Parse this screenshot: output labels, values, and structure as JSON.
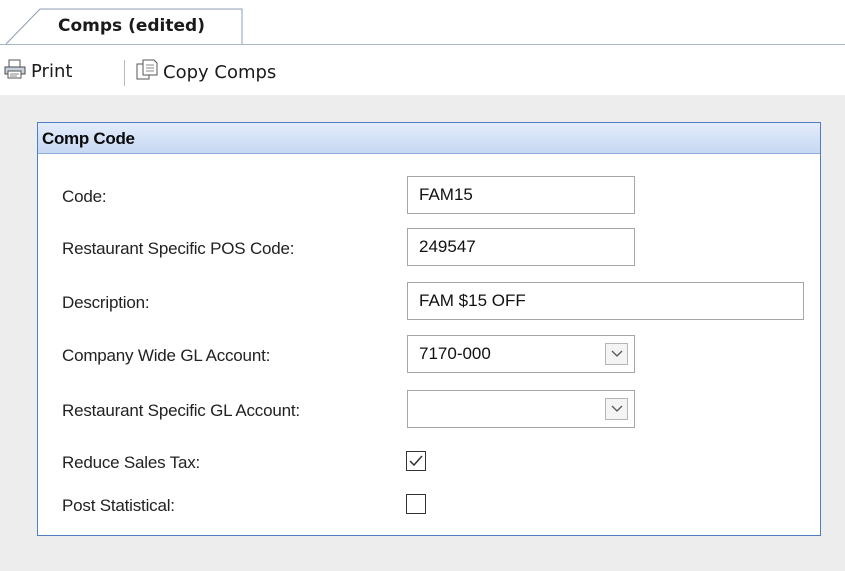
{
  "tab": {
    "title": "Comps (edited)"
  },
  "toolbar": {
    "print_label": "Print",
    "copy_label": "Copy Comps"
  },
  "panel": {
    "title": "Comp Code",
    "fields": {
      "code": {
        "label": "Code:",
        "value": "FAM15"
      },
      "pos_code": {
        "label": "Restaurant Specific POS Code:",
        "value": "249547"
      },
      "description": {
        "label": "Description:",
        "value": "FAM $15 OFF"
      },
      "company_gl": {
        "label": "Company Wide GL Account:",
        "value": "7170-000"
      },
      "restaurant_gl": {
        "label": "Restaurant Specific GL Account:",
        "value": ""
      },
      "reduce_sales_tax": {
        "label": "Reduce Sales Tax:",
        "checked": true
      },
      "post_statistical": {
        "label": "Post Statistical:",
        "checked": false
      }
    }
  },
  "icons": {
    "print": "printer-icon",
    "copy": "copy-icon",
    "combo": "chevron-down-icon",
    "check": "checkmark-icon"
  },
  "colors": {
    "panel_border": "#4f7ec4",
    "panel_header": "#c7d8f3",
    "background": "#ededed"
  }
}
